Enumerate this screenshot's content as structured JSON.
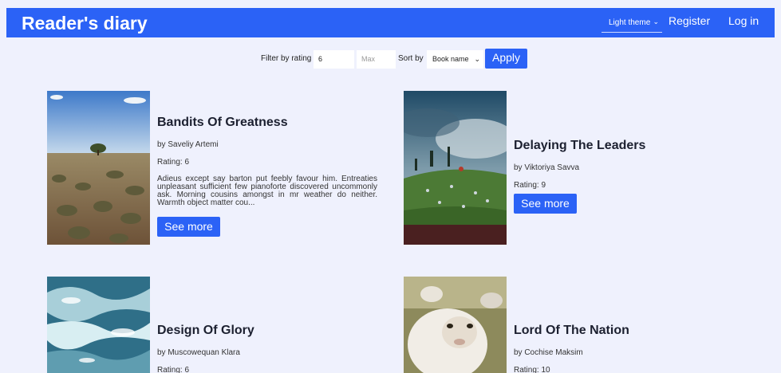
{
  "header": {
    "logo": "Reader's diary",
    "theme_select": "Light theme",
    "register": "Register",
    "login": "Log in"
  },
  "filter": {
    "rating_label": "Filter by rating",
    "min_value": "6",
    "max_placeholder": "Max",
    "sort_label": "Sort by",
    "sort_value": "Book name",
    "apply": "Apply"
  },
  "books": [
    {
      "title": "Bandits Of Greatness",
      "author": "by Saveliy Artemi",
      "rating": "Rating: 6",
      "description": "Adieus except say barton put feebly favour him. Entreaties unpleasant sufficient few pianoforte discovered uncommonly ask. Morning cousins amongst in mr weather do neither. Warmth object matter cou...",
      "see_more": "See more"
    },
    {
      "title": "Delaying The Leaders",
      "author": "by Viktoriya Savva",
      "rating": "Rating: 9",
      "see_more": "See more"
    },
    {
      "title": "Design Of Glory",
      "author": "by Muscowequan Klara",
      "rating": "Rating: 6"
    },
    {
      "title": "Lord Of The Nation",
      "author": "by Cochise Maksim",
      "rating": "Rating: 10"
    }
  ],
  "icons": {
    "chevron": "chevron-down-icon"
  }
}
